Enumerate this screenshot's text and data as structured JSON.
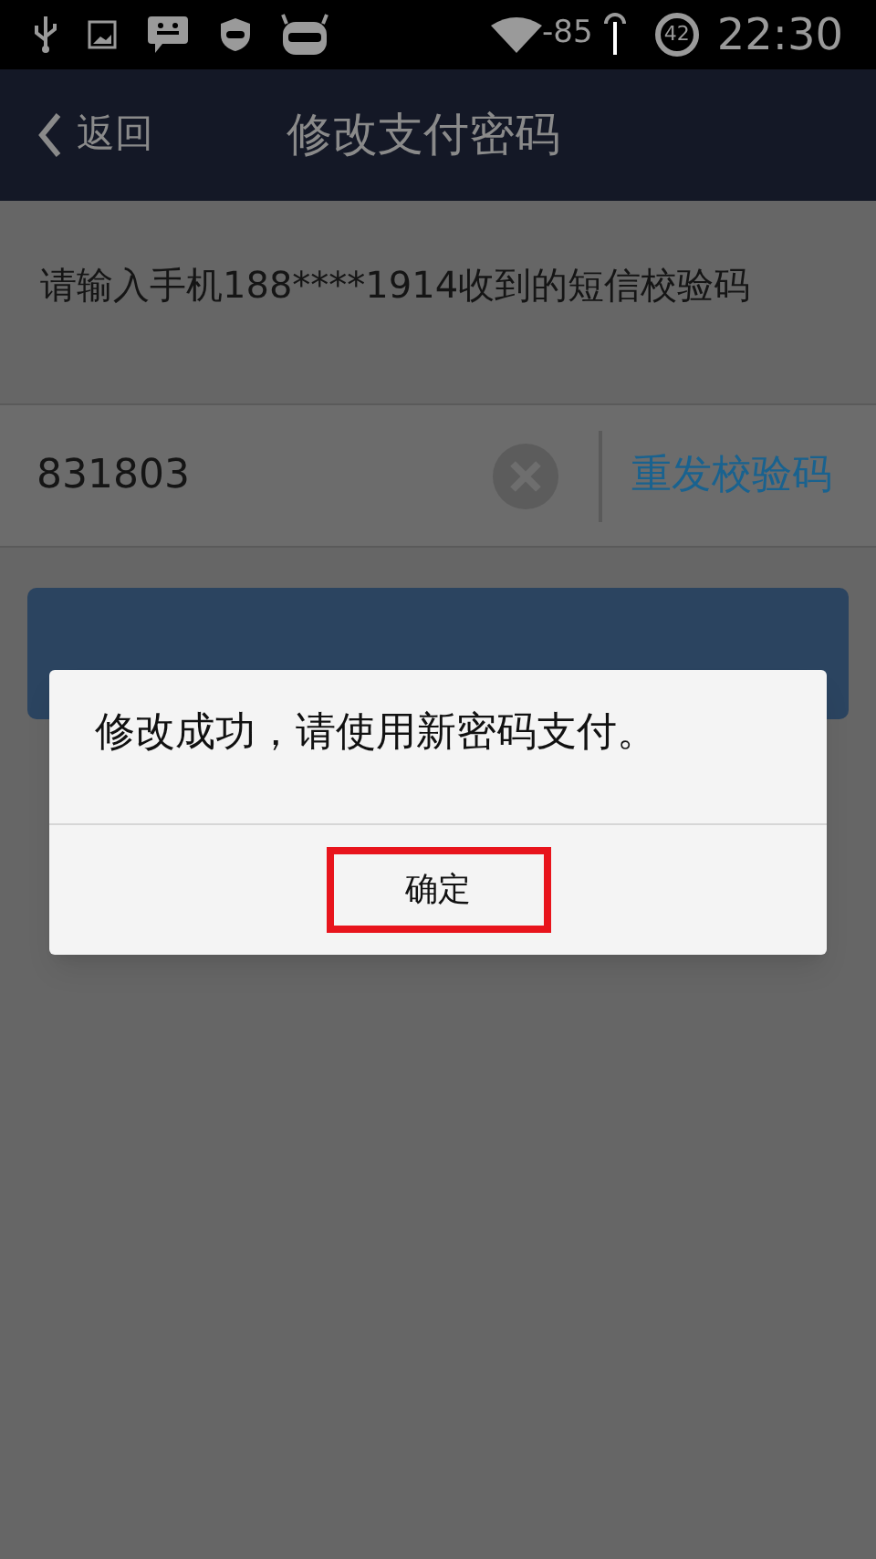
{
  "status_bar": {
    "signal_reading": "-85",
    "battery": "42",
    "time": "22:30"
  },
  "header": {
    "back_label": "返回",
    "title": "修改支付密码"
  },
  "prompt": "请输入手机188****1914收到的短信校验码",
  "code_field": {
    "value": "831803"
  },
  "resend_link": "重发校验码",
  "dialog": {
    "message": "修改成功，请使用新密码支付。",
    "button": "确定"
  }
}
